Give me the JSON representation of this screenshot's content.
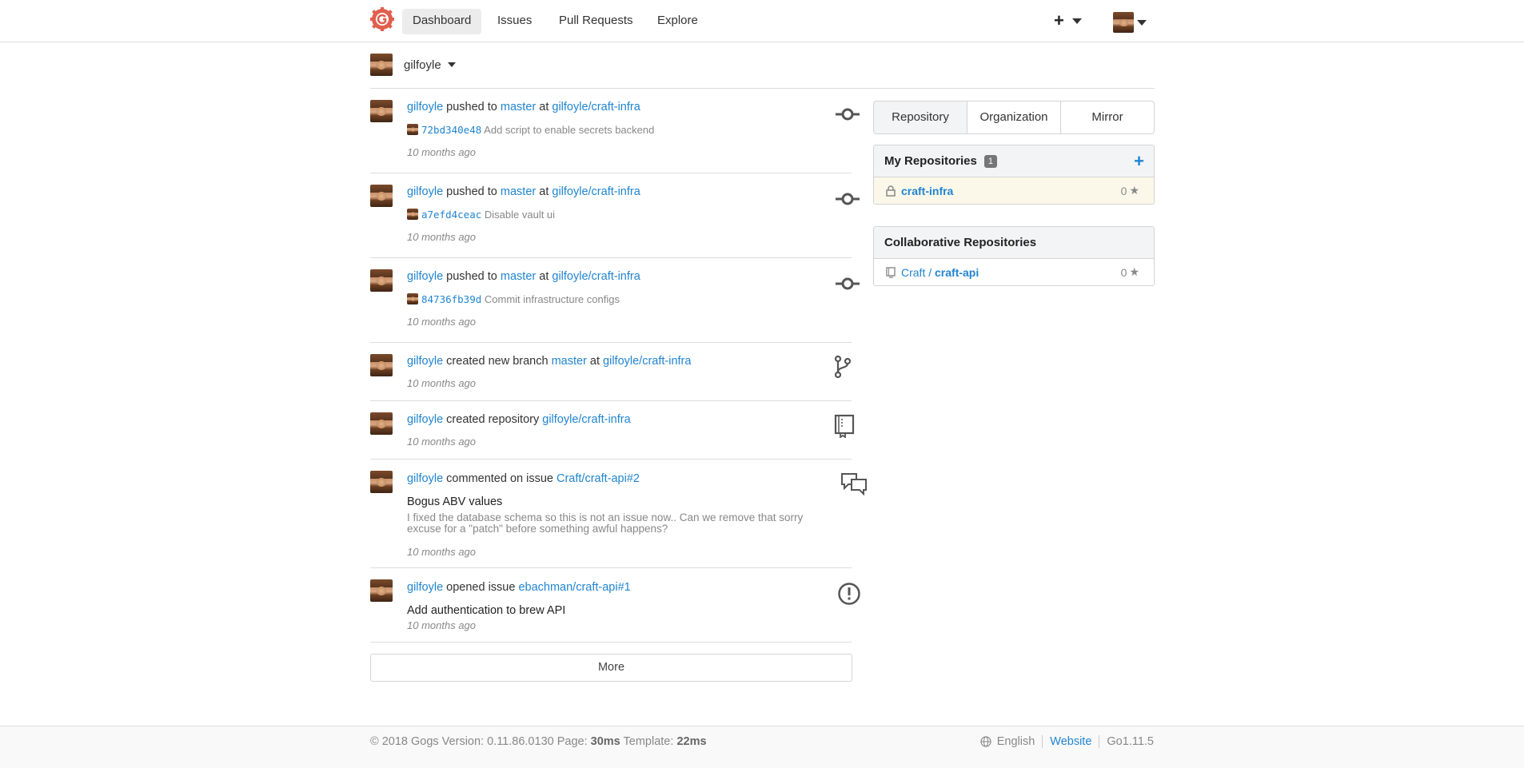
{
  "nav": {
    "items": [
      {
        "label": "Dashboard",
        "active": true
      },
      {
        "label": "Issues"
      },
      {
        "label": "Pull Requests"
      },
      {
        "label": "Explore"
      }
    ],
    "plus_icon": "plus-icon",
    "caret_icon": "caret-down-icon"
  },
  "context": {
    "user": "gilfoyle"
  },
  "feed": [
    {
      "user": "gilfoyle",
      "action": "pushed to",
      "ref": "master",
      "at": "at",
      "repo": "gilfoyle/craft-infra",
      "sha": "72bd340e48",
      "message": "Add script to enable secrets backend",
      "time": "10 months ago",
      "icon": "commit-icon"
    },
    {
      "user": "gilfoyle",
      "action": "pushed to",
      "ref": "master",
      "at": "at",
      "repo": "gilfoyle/craft-infra",
      "sha": "a7efd4ceac",
      "message": "Disable vault ui",
      "time": "10 months ago",
      "icon": "commit-icon"
    },
    {
      "user": "gilfoyle",
      "action": "pushed to",
      "ref": "master",
      "at": "at",
      "repo": "gilfoyle/craft-infra",
      "sha": "84736fb39d",
      "message": "Commit infrastructure configs",
      "time": "10 months ago",
      "icon": "commit-icon"
    },
    {
      "user": "gilfoyle",
      "action": "created new branch",
      "ref": "master",
      "at": "at",
      "repo": "gilfoyle/craft-infra",
      "time": "10 months ago",
      "icon": "git-branch-icon"
    },
    {
      "user": "gilfoyle",
      "action": "created repository",
      "repo": "gilfoyle/craft-infra",
      "time": "10 months ago",
      "icon": "repo-icon"
    },
    {
      "user": "gilfoyle",
      "action": "commented on issue",
      "repo": "Craft/craft-api#2",
      "issue_title": "Bogus ABV values",
      "issue_body": "I fixed the database schema so this is not an issue now.. Can we remove that sorry excuse for a \"patch\" before something awful happens?",
      "time": "10 months ago",
      "icon": "comment-discussion-icon"
    },
    {
      "user": "gilfoyle",
      "action": "opened issue",
      "repo": "ebachman/craft-api#1",
      "issue_title": "Add authentication to brew API",
      "time": "10 months ago",
      "icon": "issue-opened-icon"
    }
  ],
  "more_label": "More",
  "sidebar": {
    "tabs": [
      {
        "label": "Repository",
        "active": true
      },
      {
        "label": "Organization"
      },
      {
        "label": "Mirror"
      }
    ],
    "my_repos": {
      "title": "My Repositories",
      "count": "1",
      "add_icon": "plus-icon",
      "items": [
        {
          "name": "craft-infra",
          "stars": "0",
          "icon": "lock-icon"
        }
      ]
    },
    "collab_repos": {
      "title": "Collaborative Repositories",
      "items": [
        {
          "owner": "Craft",
          "separator": " / ",
          "name": "craft-api",
          "stars": "0",
          "icon": "repo-icon"
        }
      ]
    }
  },
  "footer": {
    "copyright": "© 2018 Gogs Version: 0.11.86.0130 Page:",
    "page_time": "30ms",
    "template_label": "Template:",
    "template_time": "22ms",
    "language": "English",
    "website": "Website",
    "go_version": "Go1.11.5"
  }
}
